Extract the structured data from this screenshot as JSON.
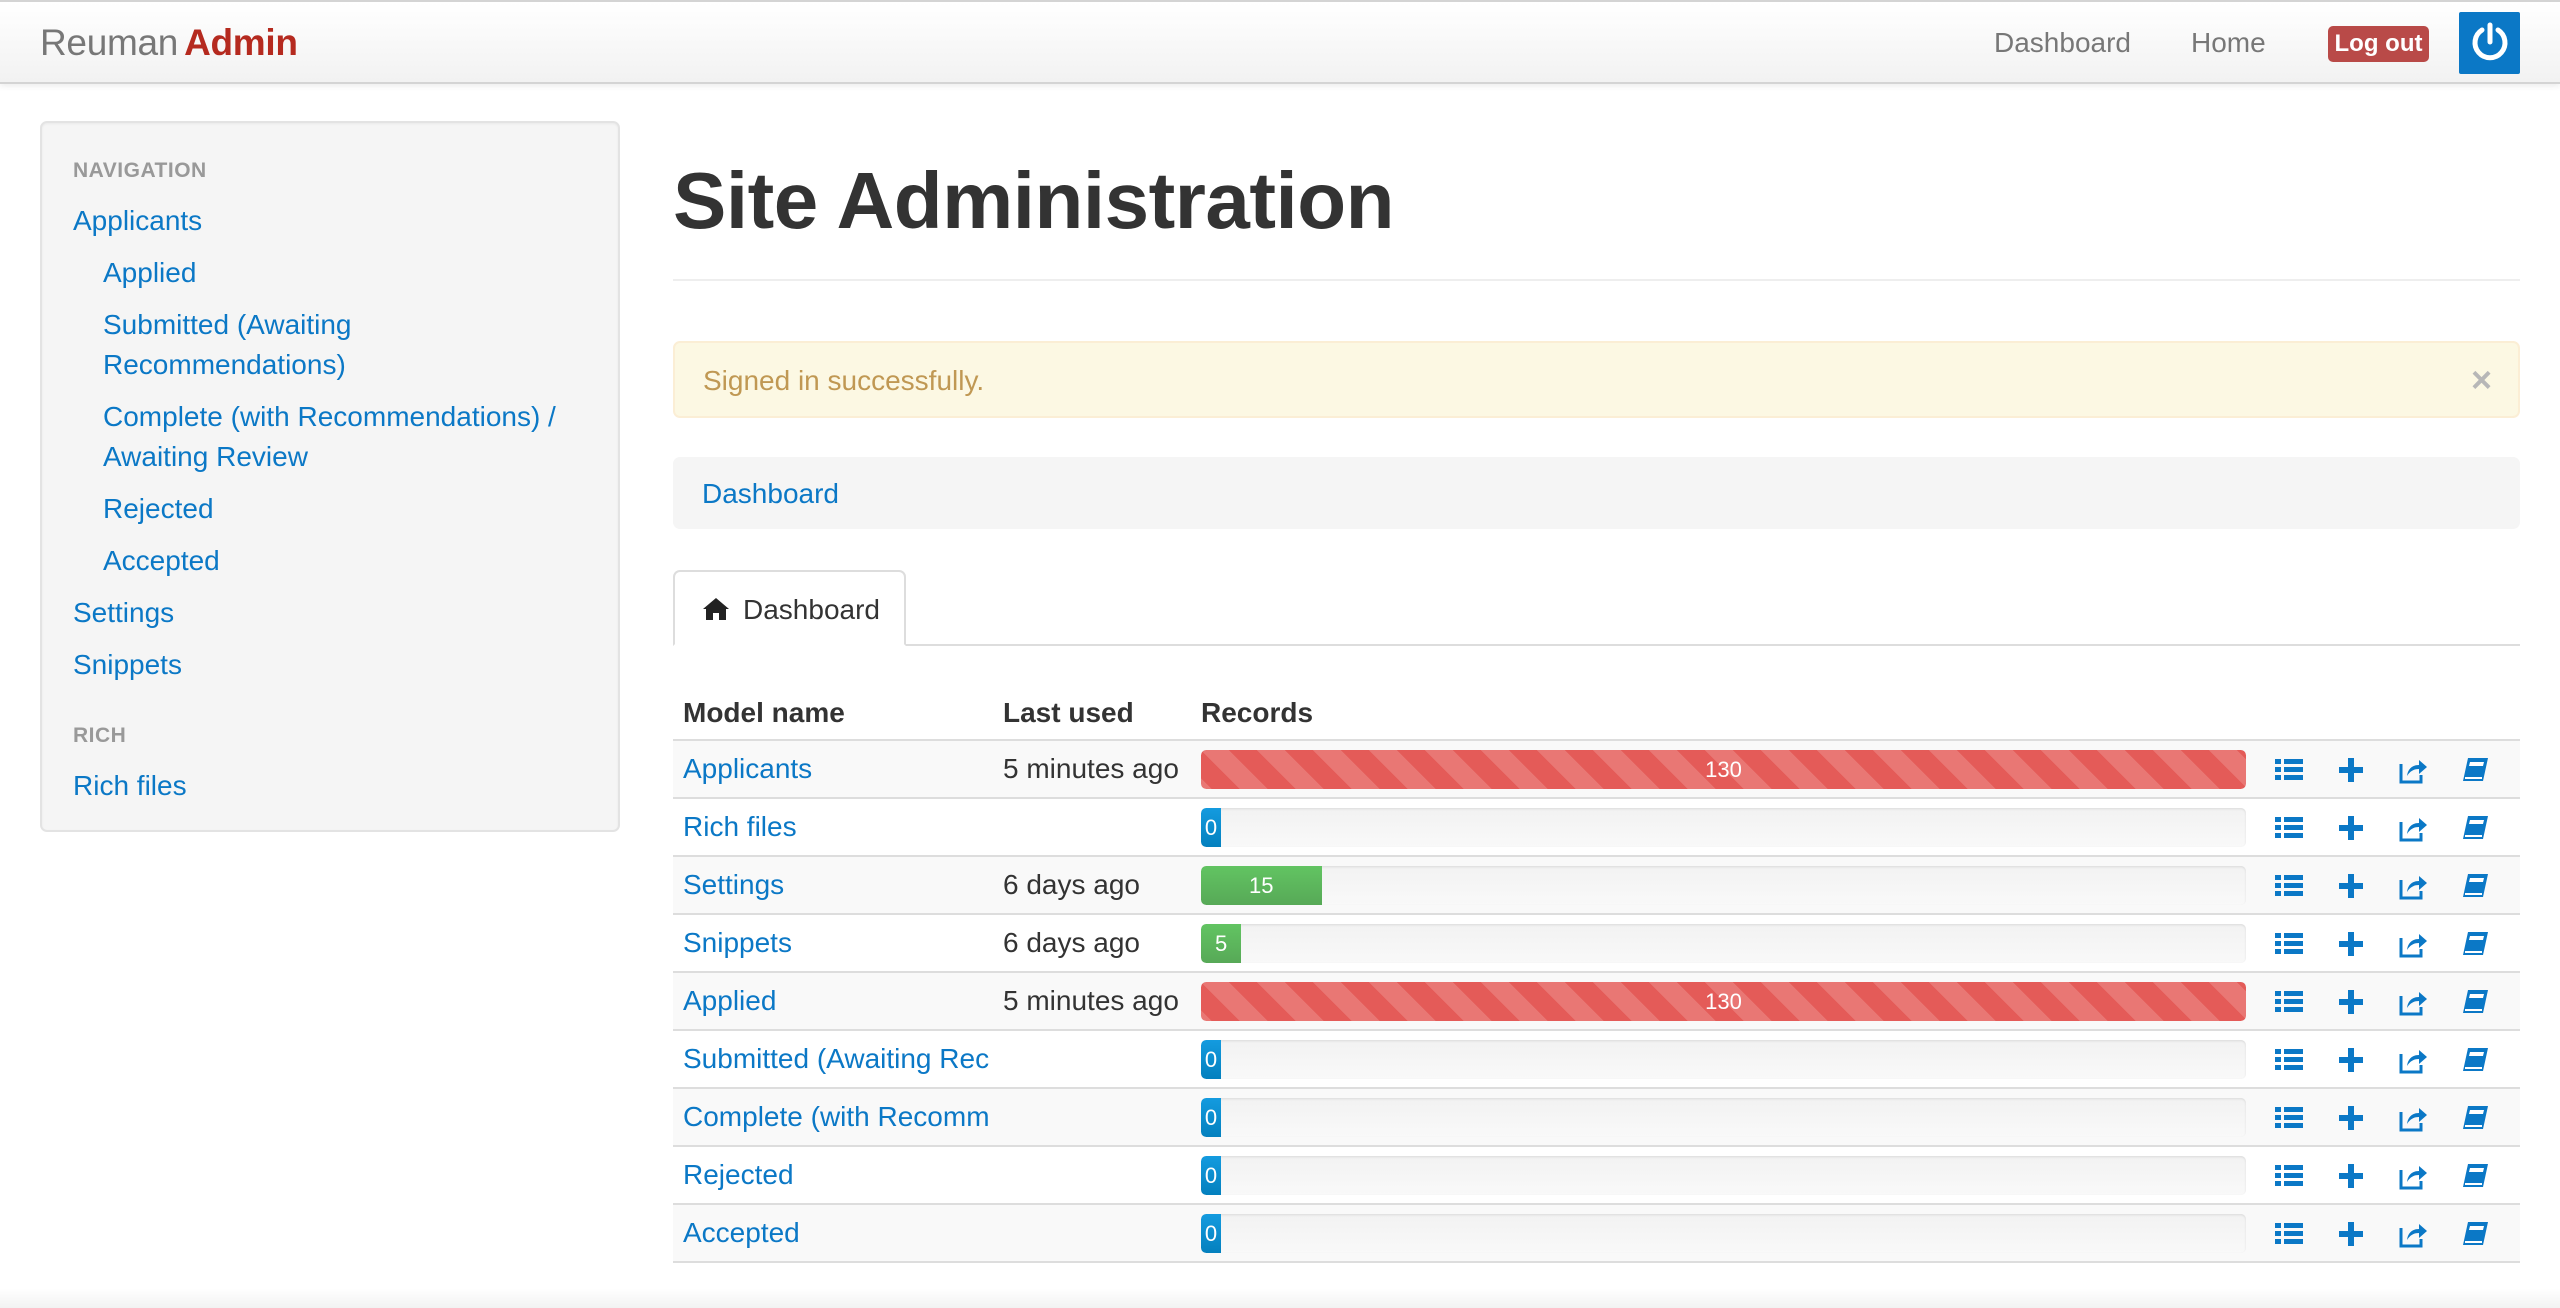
{
  "navbar": {
    "brand_light": "Reuman",
    "brand_strong": "Admin",
    "links": [
      "Dashboard",
      "Home"
    ],
    "logout_label": "Log out"
  },
  "sidebar": {
    "sections": [
      {
        "header": "Navigation",
        "items": [
          {
            "label": "Applicants",
            "level": 0
          },
          {
            "label": "Applied",
            "level": 1
          },
          {
            "label": "Submitted (Awaiting Recommendations)",
            "level": 1
          },
          {
            "label": "Complete (with Recommendations) / Awaiting Review",
            "level": 1
          },
          {
            "label": "Rejected",
            "level": 1
          },
          {
            "label": "Accepted",
            "level": 1
          },
          {
            "label": "Settings",
            "level": 0
          },
          {
            "label": "Snippets",
            "level": 0
          }
        ]
      },
      {
        "header": "Rich",
        "items": [
          {
            "label": "Rich files",
            "level": 0
          }
        ]
      }
    ]
  },
  "main": {
    "title": "Site Administration",
    "alert": {
      "message": "Signed in successfully.",
      "close": "×"
    },
    "breadcrumb": "Dashboard",
    "tab": {
      "label": "Dashboard",
      "icon": "home-icon"
    }
  },
  "table": {
    "headers": {
      "model": "Model name",
      "last_used": "Last used",
      "records": "Records"
    },
    "max_records": 130,
    "rows": [
      {
        "model": "Applicants",
        "last_used": "5 minutes ago",
        "records": 130,
        "bar_color": "red"
      },
      {
        "model": "Rich files",
        "last_used": "",
        "records": 0,
        "bar_color": "blue"
      },
      {
        "model": "Settings",
        "last_used": "6 days ago",
        "records": 15,
        "bar_color": "green"
      },
      {
        "model": "Snippets",
        "last_used": "6 days ago",
        "records": 5,
        "bar_color": "green"
      },
      {
        "model": "Applied",
        "last_used": "5 minutes ago",
        "records": 130,
        "bar_color": "red"
      },
      {
        "model": "Submitted (Awaiting Rec",
        "last_used": "",
        "records": 0,
        "bar_color": "blue"
      },
      {
        "model": "Complete (with Recomm",
        "last_used": "",
        "records": 0,
        "bar_color": "blue"
      },
      {
        "model": "Rejected",
        "last_used": "",
        "records": 0,
        "bar_color": "blue"
      },
      {
        "model": "Accepted",
        "last_used": "",
        "records": 0,
        "bar_color": "blue"
      }
    ],
    "row_actions": [
      "list-icon",
      "add-icon",
      "export-icon",
      "history-icon"
    ]
  },
  "colors": {
    "link": "#0b78c6",
    "brand_accent": "#b52a1f",
    "logout": "#b94a48",
    "bar_red": "#e45b58",
    "bar_green": "#5eb95e",
    "bar_blue": "#0b80c4",
    "alert_bg": "#fcf8e3",
    "alert_text": "#c09853"
  }
}
